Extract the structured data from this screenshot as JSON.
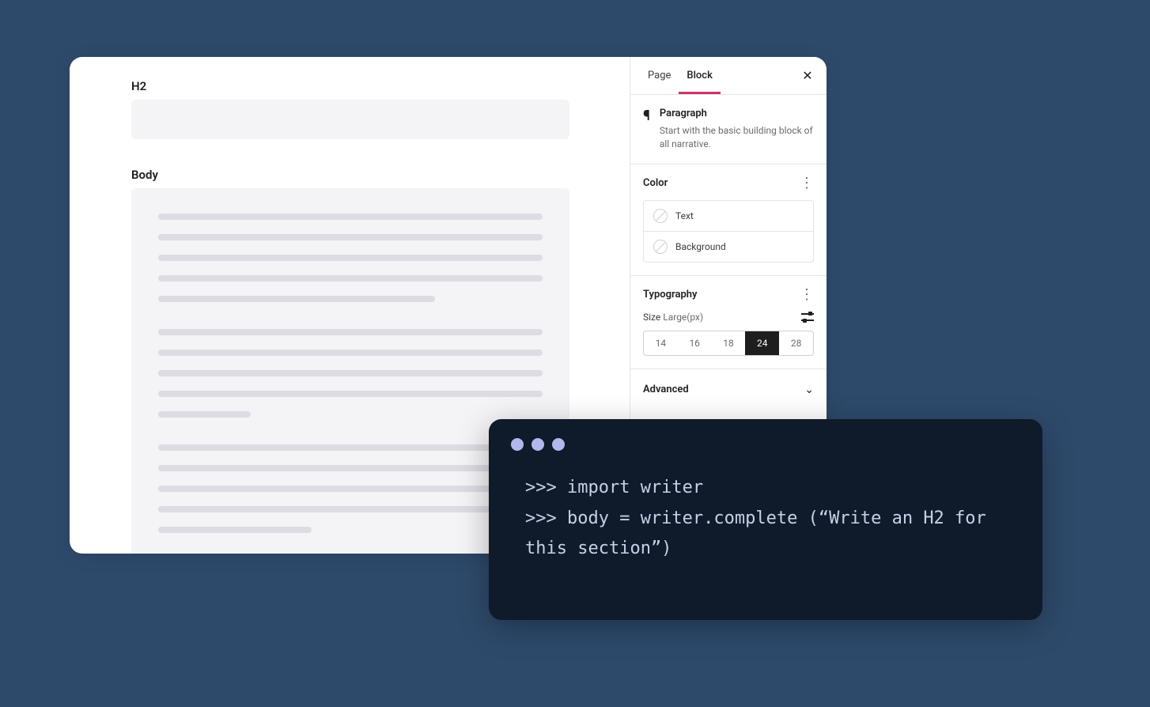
{
  "editor": {
    "h2_label": "H2",
    "body_label": "Body"
  },
  "sidebar": {
    "tabs": {
      "page": "Page",
      "block": "Block"
    },
    "block": {
      "title": "Paragraph",
      "description": "Start with the basic building block of all narrative."
    },
    "color": {
      "heading": "Color",
      "text_label": "Text",
      "background_label": "Background"
    },
    "typography": {
      "heading": "Typography",
      "size_label": "Size",
      "size_value": "Large(px)",
      "options": [
        "14",
        "16",
        "18",
        "24",
        "28"
      ],
      "selected": "24"
    },
    "advanced": {
      "heading": "Advanced"
    }
  },
  "terminal": {
    "line1": ">>> import writer",
    "line2": ">>> body = writer.complete (“Write an H2 for this section”)"
  }
}
